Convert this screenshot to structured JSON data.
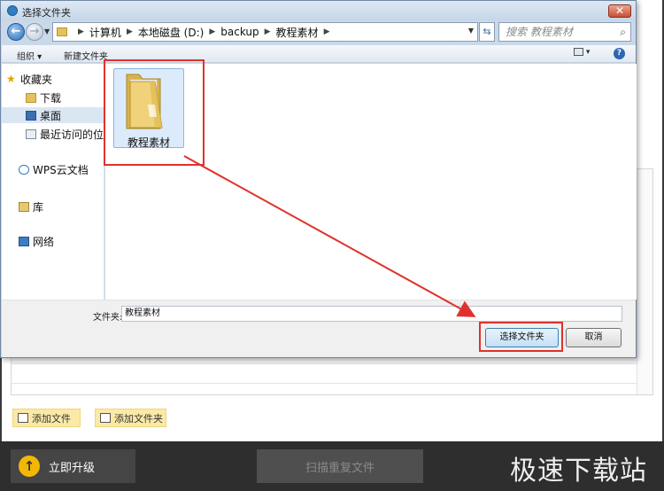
{
  "dialog": {
    "title": "选择文件夹",
    "close_glyph": "✕",
    "address": {
      "path": [
        "计算机",
        "本地磁盘 (D:)",
        "backup",
        "教程素材"
      ]
    },
    "search_placeholder": "搜索 教程素材",
    "toolbar": {
      "organize": "组织 ▾",
      "new_folder": "新建文件夹",
      "help": "?"
    },
    "nav_items": [
      {
        "label": "收藏夹",
        "icon": "star-icon"
      },
      {
        "label": "下载",
        "icon": "download-folder-icon"
      },
      {
        "label": "桌面",
        "icon": "desktop-icon",
        "selected": true
      },
      {
        "label": "最近访问的位置",
        "icon": "recent-places-icon"
      },
      {
        "label": "WPS云文档",
        "icon": "cloud-icon"
      },
      {
        "label": "库",
        "icon": "library-icon"
      },
      {
        "label": "网络",
        "icon": "network-icon"
      }
    ],
    "folder_item": {
      "label": "教程素材",
      "icon": "folder-icon"
    },
    "folder_field": {
      "label": "文件夹:",
      "value": "教程素材"
    },
    "buttons": {
      "select_folder": "选择文件夹",
      "cancel": "取消"
    },
    "colors": {
      "annotation_red": "#e0322d"
    }
  },
  "app": {
    "add_file": "添加文件",
    "add_folder": "添加文件夹",
    "upgrade": "立即升级",
    "scan_duplicates": "扫描重复文件",
    "watermark": "极速下载站"
  }
}
